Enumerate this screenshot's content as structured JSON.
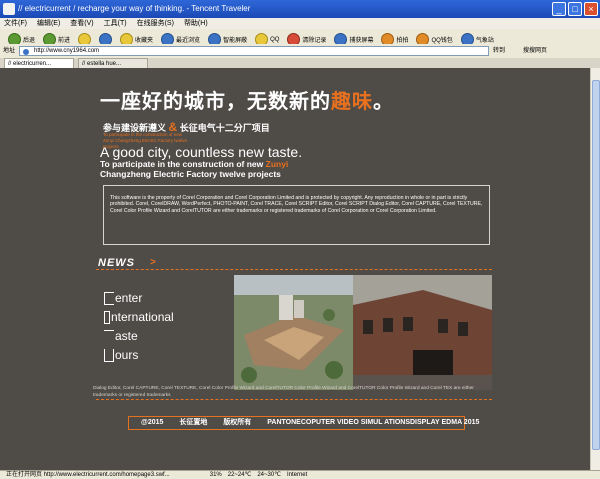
{
  "window": {
    "title": "// electricurrent / recharge your way of thinking. - Tencent Traveler"
  },
  "menu": [
    "文件(F)",
    "编辑(E)",
    "查看(V)",
    "工具(T)",
    "在线服务(S)",
    "帮助(H)"
  ],
  "toolbar": {
    "back": "后退",
    "forward": "前进",
    "favorites": "收藏夹",
    "recent": "最近浏览",
    "smart_screen": "智能屏蔽",
    "qq": "QQ",
    "clear_records": "清除记录",
    "capture": "捕获屏幕",
    "paipai": "拍拍",
    "qq_wallet": "QQ钱包",
    "weather": "气象站"
  },
  "address": {
    "label": "地址",
    "value": "http://www.cny1964.com",
    "go": "转到",
    "search": "搜搜网页"
  },
  "tabs": [
    "// electricurren...",
    "// estella hue..."
  ],
  "page": {
    "hero_cn_main": "一座好的城市，无数新的",
    "hero_cn_highlight": "趣味",
    "hero_cn_end": "。",
    "sub_cn_left": "参与建设新遵义",
    "sub_cn_amp": "&",
    "sub_cn_right": "长征电气十二分厂项目",
    "tiny_orange": "To participate in the construction of new Zunyi Changzheng Electric Factory twelve projects",
    "en_big": "A good city, countless new taste.",
    "en_sub_1": "To participate in the construction of new",
    "en_sub_zunyi": "Zunyi",
    "en_sub_2": "Changzheng Electric Factory twelve projects",
    "info_text": "This software is the property of Corel Corporation and Corel Corporation Limited and is protected by copyright. Any reproduction in whole or in part is strictly prohibited. Corel, CorelDRAW, WordPerfect, PHOTO-PAINT, Corel TRACE, Corel SCRIPT Editor, Corel SCRIPT Dialog Editor, Corel CAPTURE, Corel TEXTURE, Corel Color Profile Wizard and CorelTUTOR are either trademarks or registered trademarks of Corel Corporation or Corel Corporation Limited.",
    "news_label": "NEWS",
    "brand_words": [
      "enter",
      "nternational",
      "aste",
      "ours"
    ],
    "caption": "Dialog Editor, Corel CAPTURE, Corel TEXTURE, Corel Color Profile Wizard and CorelTUTOR Color Profile Wizard and CorelTUTOR Color Profile Wizard and Corel TEX are either trademarks or registered trademarks",
    "footer_year": "@2015",
    "footer_brand": "长征置地",
    "footer_rights": "版权所有",
    "footer_tagline": "PANTONECOPUTER VIDEO SIMUL ATIONSDISPLAY EDMA 2015"
  },
  "status": {
    "left": "正在打开网页 http://www.electricurrent.com/homepage3.swf...",
    "zoom": "31%",
    "temp": "22~24℃",
    "weather2": "24~30℃",
    "zone": "Internet"
  },
  "colors": {
    "accent": "#e8711f",
    "page_bg": "#4f4b47"
  }
}
